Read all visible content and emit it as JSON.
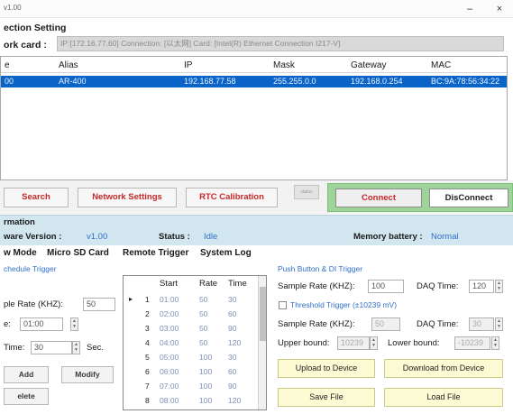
{
  "window": {
    "title": "v1.00",
    "minimize_label": "–",
    "close_label": "×"
  },
  "connection": {
    "section_title": "ection Setting",
    "netcard_label": "ork card :",
    "netcard_value": "IP:[172.16.77.60] Connection: [以太网] Card: [Intel(R) Ethernet Connection I217-V]"
  },
  "device_grid": {
    "columns": [
      "e",
      "Alias",
      "IP",
      "Mask",
      "Gateway",
      "MAC"
    ],
    "rows": [
      {
        "name": "00",
        "alias": "AR-400",
        "ip": "192.168.77.58",
        "mask": "255.255.0.0",
        "gateway": "192.168.0.254",
        "mac": "BC:9A:78:56:34:22"
      }
    ]
  },
  "buttons": {
    "search": "Search",
    "network_settings": "Network Settings",
    "rtc_calibration": "RTC Calibration",
    "led": "status",
    "connect": "Connect",
    "disconnect": "DisConnect"
  },
  "info": {
    "header": "rmation",
    "firmware_label": "ware Version :",
    "firmware_value": "v1.00",
    "status_label": "Status :",
    "status_value": "Idle",
    "battery_label": "Memory battery :",
    "battery_value": "Normal",
    "accent": "#2e6fc9"
  },
  "tabs": [
    "w Mode",
    "Micro SD Card",
    "Remote Trigger",
    "System Log"
  ],
  "schedule": {
    "title": "chedule Trigger",
    "sample_rate_label": "ple Rate (KHZ):",
    "sample_rate_value": "50",
    "start_label": "e:",
    "start_value": "01:00",
    "daq_label": "Time:",
    "daq_value": "30",
    "daq_unit": "Sec.",
    "add": "Add",
    "modify": "Modify",
    "delete": "elete"
  },
  "schedule_table": {
    "columns": [
      "Start",
      "Rate",
      "Time"
    ],
    "rows": [
      {
        "n": "1",
        "start": "01:00",
        "rate": "50",
        "time": "30"
      },
      {
        "n": "2",
        "start": "02:00",
        "rate": "50",
        "time": "60"
      },
      {
        "n": "3",
        "start": "03:00",
        "rate": "50",
        "time": "90"
      },
      {
        "n": "4",
        "start": "04:00",
        "rate": "50",
        "time": "120"
      },
      {
        "n": "5",
        "start": "05:00",
        "rate": "100",
        "time": "30"
      },
      {
        "n": "6",
        "start": "06:00",
        "rate": "100",
        "time": "60"
      },
      {
        "n": "7",
        "start": "07:00",
        "rate": "100",
        "time": "90"
      },
      {
        "n": "8",
        "start": "08:00",
        "rate": "100",
        "time": "120"
      }
    ],
    "current_row_marker": "▸"
  },
  "push": {
    "title": "Push Button & DI Trigger",
    "sample_rate_label": "Sample Rate (KHZ):",
    "sample_rate_value": "100",
    "daq_label": "DAQ Time:",
    "daq_value": "120",
    "threshold_label": "Threshold Trigger (±10239 mV)",
    "sample_rate2_label": "Sample Rate (KHZ):",
    "sample_rate2_value": "50",
    "daq2_label": "DAQ Time:",
    "daq2_value": "30",
    "upper_label": "Upper bound:",
    "upper_value": "10239",
    "lower_label": "Lower bound:",
    "lower_value": "-10239",
    "upload": "Upload to Device",
    "download": "Download from Device",
    "save": "Save File",
    "load": "Load File"
  }
}
